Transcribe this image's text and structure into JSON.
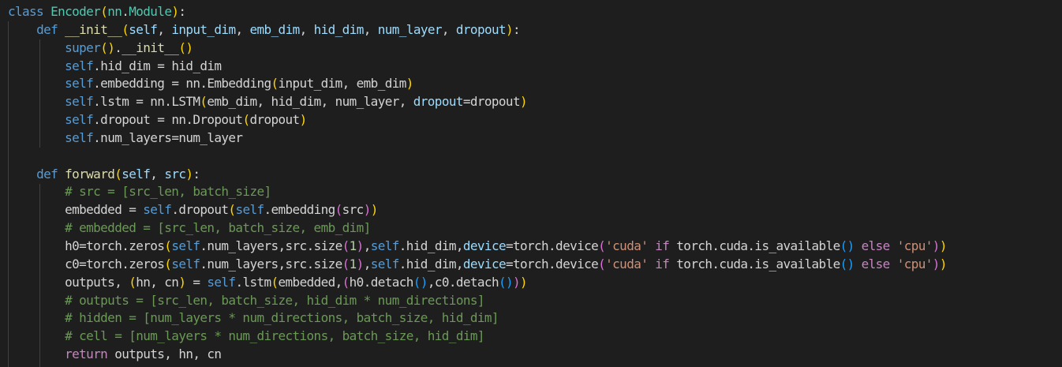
{
  "theme": {
    "background": "#1e1e1e",
    "default_text": "#d4d4d4",
    "keyword_blue": "#569cd6",
    "keyword_purple": "#c586c0",
    "class_name": "#4ec9b0",
    "function": "#dcdcaa",
    "parameter": "#9cdcfe",
    "string": "#ce9178",
    "number": "#b5cea8",
    "comment": "#6a9955",
    "bracket_level_1": "#ffd700",
    "bracket_level_2": "#da70d6",
    "bracket_level_3": "#179fff"
  },
  "code": {
    "lines": [
      {
        "tokens": [
          [
            "kw-b",
            "class"
          ],
          [
            "txt",
            " "
          ],
          [
            "cls",
            "Encoder"
          ],
          [
            "b1",
            "("
          ],
          [
            "cls",
            "nn"
          ],
          [
            "txt",
            "."
          ],
          [
            "cls",
            "Module"
          ],
          [
            "b1",
            ")"
          ],
          [
            "txt",
            ":"
          ]
        ]
      },
      {
        "tokens": [
          [
            "txt",
            "    "
          ],
          [
            "kw-b",
            "def"
          ],
          [
            "txt",
            " "
          ],
          [
            "fn",
            "__init__"
          ],
          [
            "b1",
            "("
          ],
          [
            "var",
            "self"
          ],
          [
            "txt",
            ", "
          ],
          [
            "var",
            "input_dim"
          ],
          [
            "txt",
            ", "
          ],
          [
            "var",
            "emb_dim"
          ],
          [
            "txt",
            ", "
          ],
          [
            "var",
            "hid_dim"
          ],
          [
            "txt",
            ", "
          ],
          [
            "var",
            "num_layer"
          ],
          [
            "txt",
            ", "
          ],
          [
            "var",
            "dropout"
          ],
          [
            "b1",
            ")"
          ],
          [
            "txt",
            ":"
          ]
        ]
      },
      {
        "tokens": [
          [
            "txt",
            "        "
          ],
          [
            "kw-b",
            "super"
          ],
          [
            "b1",
            "("
          ],
          [
            "b1",
            ")"
          ],
          [
            "txt",
            "."
          ],
          [
            "fn",
            "__init__"
          ],
          [
            "b1",
            "("
          ],
          [
            "b1",
            ")"
          ]
        ]
      },
      {
        "tokens": [
          [
            "txt",
            "        "
          ],
          [
            "self",
            "self"
          ],
          [
            "txt",
            "."
          ],
          [
            "txt",
            "hid_dim = hid_dim"
          ]
        ]
      },
      {
        "tokens": [
          [
            "txt",
            "        "
          ],
          [
            "self",
            "self"
          ],
          [
            "txt",
            ".embedding = nn.Embedding"
          ],
          [
            "b1",
            "("
          ],
          [
            "txt",
            "input_dim, emb_dim"
          ],
          [
            "b1",
            ")"
          ]
        ]
      },
      {
        "tokens": [
          [
            "txt",
            "        "
          ],
          [
            "self",
            "self"
          ],
          [
            "txt",
            ".lstm = nn.LSTM"
          ],
          [
            "b1",
            "("
          ],
          [
            "txt",
            "emb_dim, hid_dim, num_layer, "
          ],
          [
            "var",
            "dropout"
          ],
          [
            "txt",
            "=dropout"
          ],
          [
            "b1",
            ")"
          ]
        ]
      },
      {
        "tokens": [
          [
            "txt",
            "        "
          ],
          [
            "self",
            "self"
          ],
          [
            "txt",
            ".dropout = nn.Dropout"
          ],
          [
            "b1",
            "("
          ],
          [
            "txt",
            "dropout"
          ],
          [
            "b1",
            ")"
          ]
        ]
      },
      {
        "tokens": [
          [
            "txt",
            "        "
          ],
          [
            "self",
            "self"
          ],
          [
            "txt",
            ".num_layers=num_layer"
          ]
        ]
      },
      {
        "tokens": [
          [
            "txt",
            " "
          ]
        ]
      },
      {
        "tokens": [
          [
            "txt",
            "    "
          ],
          [
            "kw-b",
            "def"
          ],
          [
            "txt",
            " "
          ],
          [
            "fn",
            "forward"
          ],
          [
            "b1",
            "("
          ],
          [
            "var",
            "self"
          ],
          [
            "txt",
            ", "
          ],
          [
            "var",
            "src"
          ],
          [
            "b1",
            ")"
          ],
          [
            "txt",
            ":"
          ]
        ]
      },
      {
        "tokens": [
          [
            "txt",
            "        "
          ],
          [
            "com",
            "# src = [src_len, batch_size]"
          ]
        ]
      },
      {
        "tokens": [
          [
            "txt",
            "        embedded = "
          ],
          [
            "self",
            "self"
          ],
          [
            "txt",
            ".dropout"
          ],
          [
            "b1",
            "("
          ],
          [
            "self",
            "self"
          ],
          [
            "txt",
            ".embedding"
          ],
          [
            "b2",
            "("
          ],
          [
            "txt",
            "src"
          ],
          [
            "b2",
            ")"
          ],
          [
            "b1",
            ")"
          ]
        ]
      },
      {
        "tokens": [
          [
            "txt",
            "        "
          ],
          [
            "com",
            "# embedded = [src_len, batch_size, emb_dim]"
          ]
        ]
      },
      {
        "tokens": [
          [
            "txt",
            "        h0=torch.zeros"
          ],
          [
            "b1",
            "("
          ],
          [
            "self",
            "self"
          ],
          [
            "txt",
            ".num_layers,src.size"
          ],
          [
            "b2",
            "("
          ],
          [
            "num",
            "1"
          ],
          [
            "b2",
            ")"
          ],
          [
            "txt",
            ","
          ],
          [
            "self",
            "self"
          ],
          [
            "txt",
            ".hid_dim,"
          ],
          [
            "var",
            "device"
          ],
          [
            "txt",
            "=torch.device"
          ],
          [
            "b2",
            "("
          ],
          [
            "str",
            "'cuda'"
          ],
          [
            "txt",
            " "
          ],
          [
            "kw-p",
            "if"
          ],
          [
            "txt",
            " torch.cuda.is_available"
          ],
          [
            "b3",
            "("
          ],
          [
            "b3",
            ")"
          ],
          [
            "txt",
            " "
          ],
          [
            "kw-p",
            "else"
          ],
          [
            "txt",
            " "
          ],
          [
            "str",
            "'cpu'"
          ],
          [
            "b2",
            ")"
          ],
          [
            "b1",
            ")"
          ]
        ]
      },
      {
        "tokens": [
          [
            "txt",
            "        c0=torch.zeros"
          ],
          [
            "b1",
            "("
          ],
          [
            "self",
            "self"
          ],
          [
            "txt",
            ".num_layers,src.size"
          ],
          [
            "b2",
            "("
          ],
          [
            "num",
            "1"
          ],
          [
            "b2",
            ")"
          ],
          [
            "txt",
            ","
          ],
          [
            "self",
            "self"
          ],
          [
            "txt",
            ".hid_dim,"
          ],
          [
            "var",
            "device"
          ],
          [
            "txt",
            "=torch.device"
          ],
          [
            "b2",
            "("
          ],
          [
            "str",
            "'cuda'"
          ],
          [
            "txt",
            " "
          ],
          [
            "kw-p",
            "if"
          ],
          [
            "txt",
            " torch.cuda.is_available"
          ],
          [
            "b3",
            "("
          ],
          [
            "b3",
            ")"
          ],
          [
            "txt",
            " "
          ],
          [
            "kw-p",
            "else"
          ],
          [
            "txt",
            " "
          ],
          [
            "str",
            "'cpu'"
          ],
          [
            "b2",
            ")"
          ],
          [
            "b1",
            ")"
          ]
        ]
      },
      {
        "tokens": [
          [
            "txt",
            "        outputs, "
          ],
          [
            "b1",
            "("
          ],
          [
            "txt",
            "hn, cn"
          ],
          [
            "b1",
            ")"
          ],
          [
            "txt",
            " = "
          ],
          [
            "self",
            "self"
          ],
          [
            "txt",
            ".lstm"
          ],
          [
            "b1",
            "("
          ],
          [
            "txt",
            "embedded,"
          ],
          [
            "b2",
            "("
          ],
          [
            "txt",
            "h0.detach"
          ],
          [
            "b3",
            "("
          ],
          [
            "b3",
            ")"
          ],
          [
            "txt",
            ",c0.detach"
          ],
          [
            "b3",
            "("
          ],
          [
            "b3",
            ")"
          ],
          [
            "b2",
            ")"
          ],
          [
            "b1",
            ")"
          ]
        ]
      },
      {
        "tokens": [
          [
            "txt",
            "        "
          ],
          [
            "com",
            "# outputs = [src_len, batch_size, hid_dim * num_directions]"
          ]
        ]
      },
      {
        "tokens": [
          [
            "txt",
            "        "
          ],
          [
            "com",
            "# hidden = [num_layers * num_directions, batch_size, hid_dim]"
          ]
        ]
      },
      {
        "tokens": [
          [
            "txt",
            "        "
          ],
          [
            "com",
            "# cell = [num_layers * num_directions, batch_size, hid_dim]"
          ]
        ]
      },
      {
        "tokens": [
          [
            "txt",
            "        "
          ],
          [
            "kw-p",
            "return"
          ],
          [
            "txt",
            " outputs, hn, cn"
          ]
        ]
      }
    ]
  }
}
